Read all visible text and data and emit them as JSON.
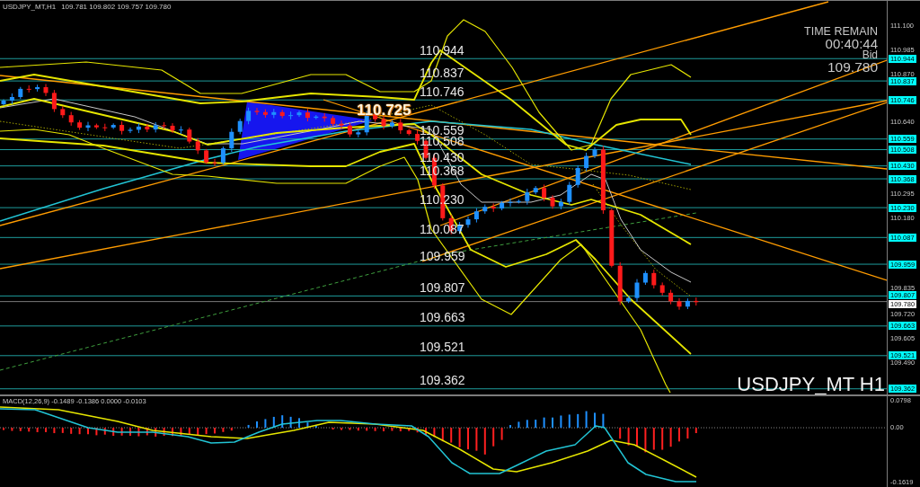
{
  "chart_window": {
    "symbol": "USDJPY_MT,H1",
    "quote": "109.781 109.802 109.757 109.780"
  },
  "price_panel": {
    "highlight_label": "110.725",
    "levels": [
      {
        "chart_label": "110.944",
        "axis_tag": "110.944"
      },
      {
        "chart_label": "110.837",
        "axis_tag": "110.837"
      },
      {
        "chart_label": "110.746",
        "axis_tag": "110.746"
      },
      {
        "chart_label": "110.559",
        "axis_tag": "110.559"
      },
      {
        "chart_label": "110.508",
        "axis_tag": "110.508"
      },
      {
        "chart_label": "110.430",
        "axis_tag": "110.430"
      },
      {
        "chart_label": "110.368",
        "axis_tag": "110.368"
      },
      {
        "chart_label": "110.230",
        "axis_tag": "110.230"
      },
      {
        "chart_label": "110.087",
        "axis_tag": "110.087"
      },
      {
        "chart_label": "109.959",
        "axis_tag": "109.959"
      },
      {
        "chart_label": "109.807",
        "axis_tag": "109.807"
      },
      {
        "chart_label": "109.663",
        "axis_tag": "109.663"
      },
      {
        "chart_label": "109.521",
        "axis_tag": "109.521"
      },
      {
        "chart_label": "109.362",
        "axis_tag": "109.362"
      }
    ],
    "info": {
      "title": "TIME REMAIN",
      "countdown": "00:40:44",
      "bid_label": "Bid",
      "bid_value": "109.780"
    },
    "caption": "USDJPY_MT H1",
    "price_axis": {
      "ticks": [
        "111.100",
        "110.985",
        "110.870",
        "110.640",
        "110.295",
        "110.180",
        "109.835",
        "109.720",
        "109.605",
        "109.490"
      ],
      "bid_tag": "109.780"
    }
  },
  "macd_panel": {
    "label": "MACD(12,26,9) -0.1489 -0.1386 0.0000 -0.0103",
    "axis_ticks": [
      "0.0798",
      "0.00",
      "-0.1619"
    ]
  }
}
